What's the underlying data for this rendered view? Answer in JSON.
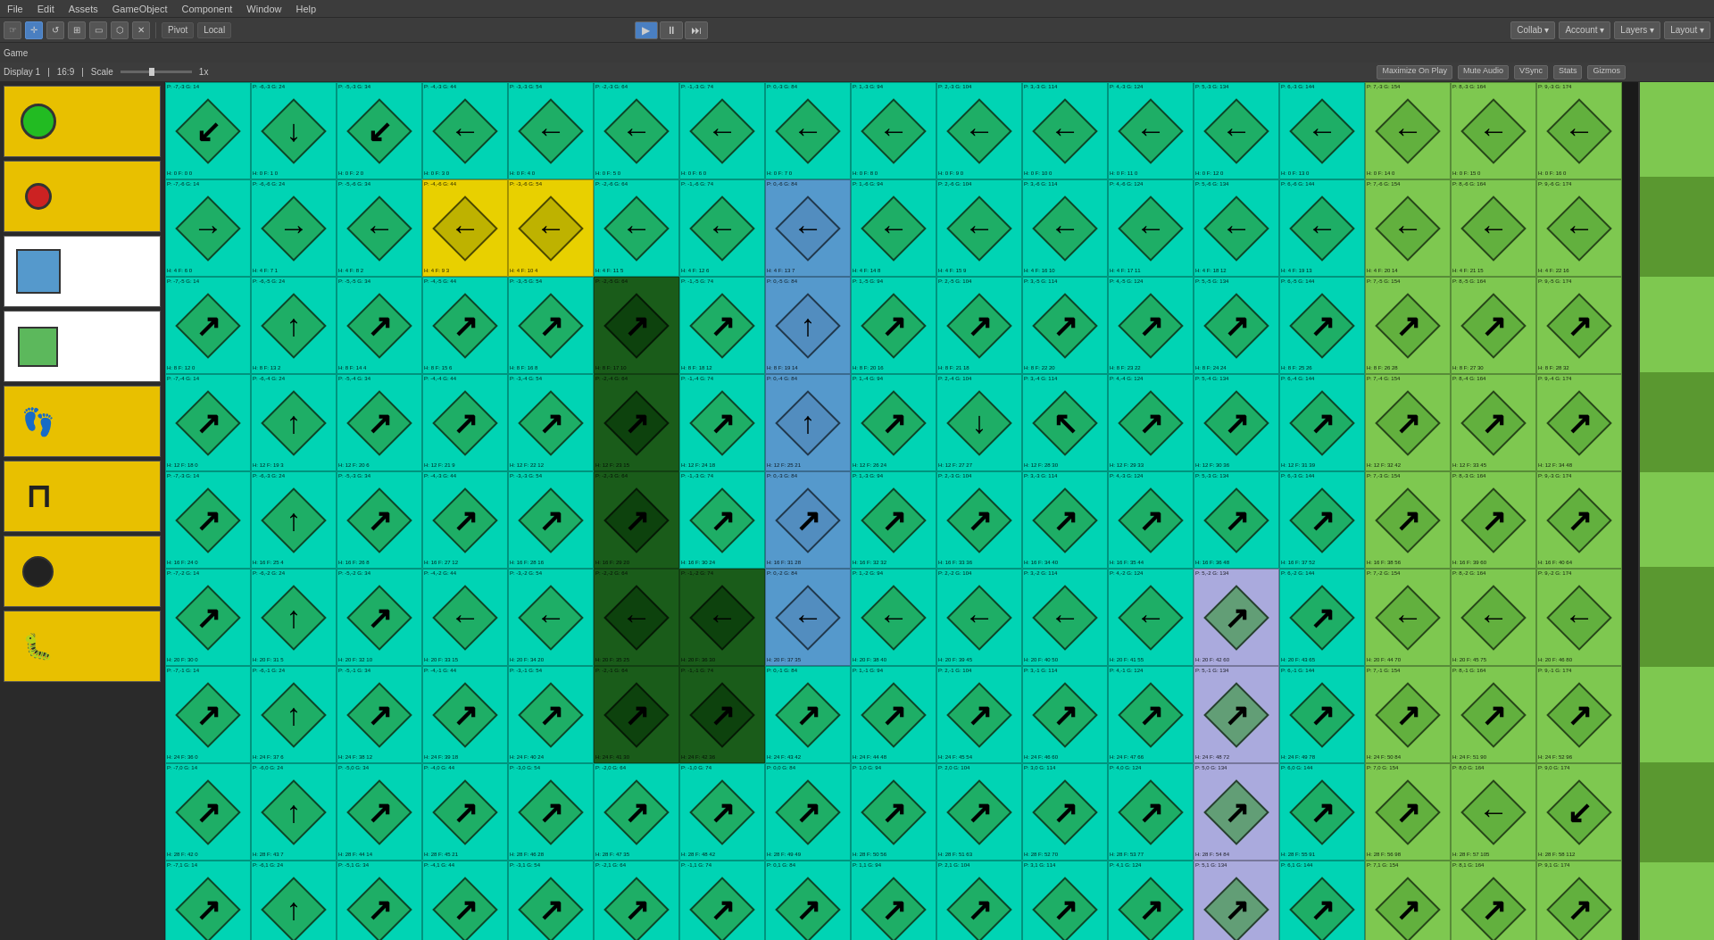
{
  "menubar": {
    "items": [
      "File",
      "Edit",
      "Assets",
      "GameObject",
      "Component",
      "Window",
      "Help"
    ]
  },
  "toolbar": {
    "tools": [
      "⊕",
      "✛",
      "↺",
      "⊞",
      "▭",
      "⬡",
      "✕"
    ],
    "pivot_label": "Pivot",
    "local_label": "Local",
    "play_icon": "▶",
    "pause_icon": "⏸",
    "step_icon": "⏭",
    "collab_label": "Collab ▾",
    "account_label": "Account ▾",
    "layers_label": "Layers ▾",
    "layout_label": "Layout ▾"
  },
  "scene_options": {
    "display_label": "Display 1",
    "ratio_label": "16:9",
    "scale_label": "Scale",
    "scale_value": "1x",
    "maximize_label": "Maximize On Play",
    "mute_label": "Mute Audio",
    "vsync_label": "VSync",
    "stats_label": "Stats",
    "gizmos_label": "Gizmos"
  },
  "window_title": "Game",
  "left_panel": {
    "tiles": [
      {
        "id": "tile-green-circle",
        "bg": "yellow",
        "icon_type": "circle-green"
      },
      {
        "id": "tile-red-circle",
        "bg": "yellow",
        "icon_type": "circle-red"
      },
      {
        "id": "tile-blue-square",
        "bg": "white",
        "icon_type": "square-blue"
      },
      {
        "id": "tile-green-square",
        "bg": "white",
        "icon_type": "square-green"
      },
      {
        "id": "tile-footprint",
        "bg": "yellow",
        "icon_type": "footprint"
      },
      {
        "id": "tile-bracket",
        "bg": "yellow",
        "icon_type": "bracket"
      },
      {
        "id": "tile-black-circle",
        "bg": "yellow",
        "icon_type": "circle-black"
      },
      {
        "id": "tile-bug",
        "bg": "yellow",
        "icon_type": "bug"
      }
    ]
  },
  "grid": {
    "rows": 9,
    "cols": 17,
    "cell_size": 88
  },
  "colors": {
    "cyan": "#00d4b4",
    "yellow": "#e8d000",
    "dark_green": "#1a5c1a",
    "blue": "#5599cc",
    "light_green": "#7ec850",
    "light_purple": "#aaaadd",
    "olive": "#888833",
    "accent": "#4a7fc1"
  }
}
